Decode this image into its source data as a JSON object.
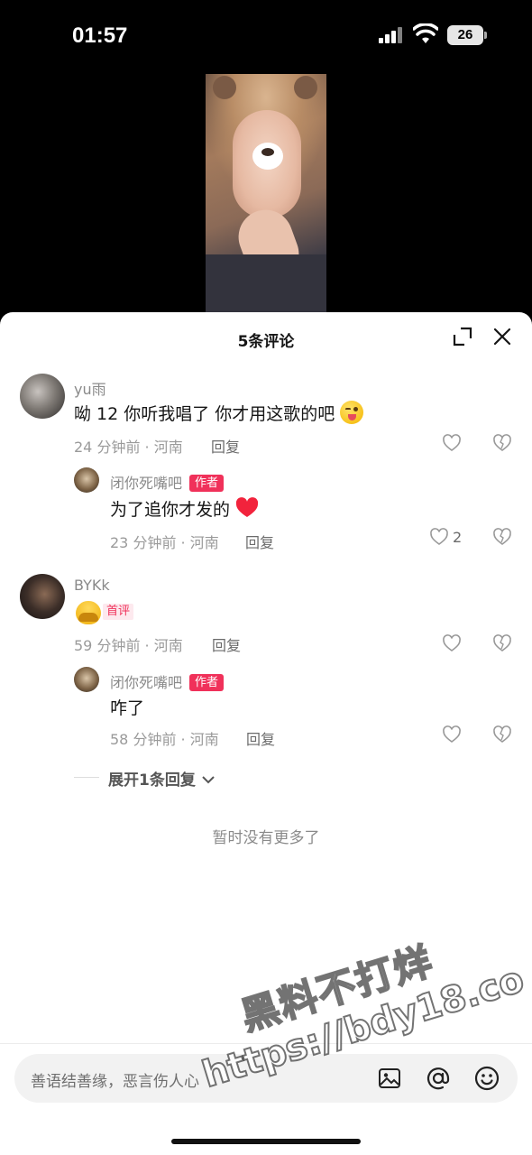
{
  "status_bar": {
    "time": "01:57",
    "battery": "26"
  },
  "sheet": {
    "title": "5条评论"
  },
  "comments": [
    {
      "name": "yu雨",
      "content": "呦 12 你听我唱了 你才用这歌的吧",
      "meta": "24 分钟前 · 河南",
      "reply_label": "回复",
      "reply": {
        "name": "闭你死嘴吧",
        "badge": "作者",
        "content": "为了追你才发的",
        "meta": "23 分钟前 · 河南",
        "reply_label": "回复",
        "likes": "2"
      }
    },
    {
      "name": "BYKk",
      "first_badge": "首评",
      "meta": "59 分钟前 · 河南",
      "reply_label": "回复",
      "reply": {
        "name": "闭你死嘴吧",
        "badge": "作者",
        "content": "咋了",
        "meta": "58 分钟前 · 河南",
        "reply_label": "回复"
      }
    }
  ],
  "expand_replies": "展开1条回复",
  "no_more": "暂时没有更多了",
  "input": {
    "placeholder": "善语结善缘，恶言伤人心"
  },
  "watermark": {
    "line1": "黑料不打烊",
    "line2": "https://bdy18.co"
  }
}
